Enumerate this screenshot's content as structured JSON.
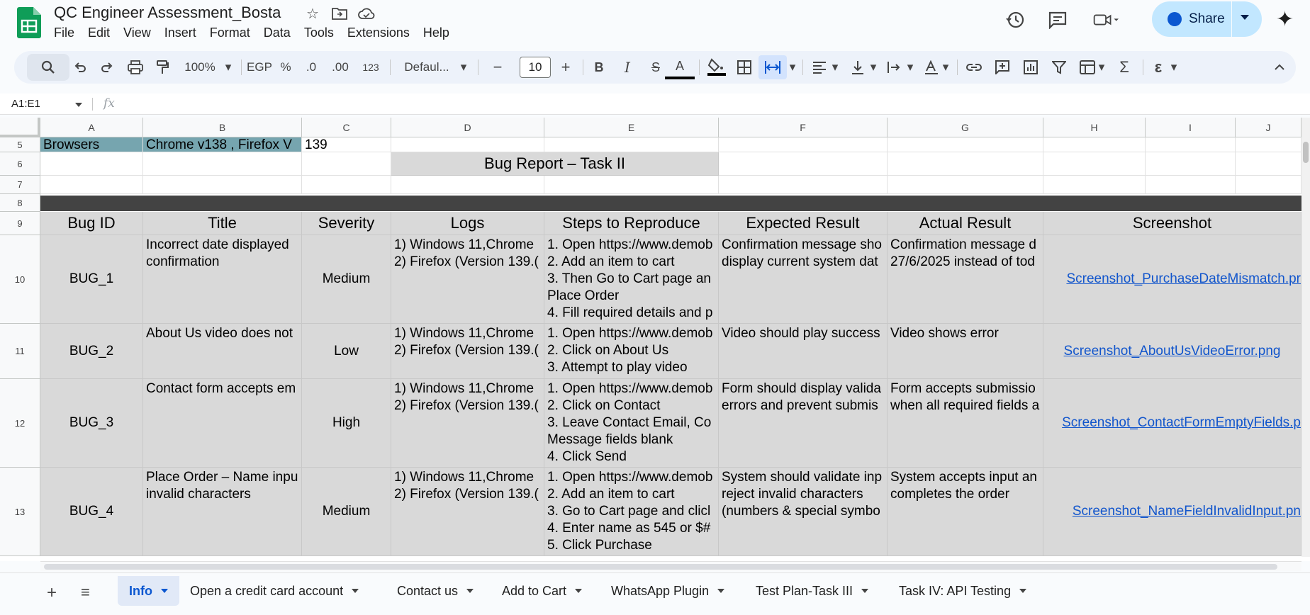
{
  "doc": {
    "title": "QC Engineer Assessment_Bosta",
    "menu": [
      "File",
      "Edit",
      "View",
      "Insert",
      "Format",
      "Data",
      "Tools",
      "Extensions",
      "Help"
    ],
    "share_label": "Share"
  },
  "toolbar": {
    "zoom": "100%",
    "currency": "EGP",
    "percent": "%",
    "dec_decrease": ".0",
    "dec_increase": ".00",
    "number_format": "123",
    "font": "Defaul...",
    "font_size": "10",
    "minus": "−",
    "plus": "+",
    "bold": "B",
    "italic": "I",
    "strike": "S",
    "text_color": "A",
    "sum": "Σ"
  },
  "formula_bar": {
    "name_box": "A1:E1",
    "fx": "fx"
  },
  "columns": [
    "A",
    "B",
    "C",
    "D",
    "E",
    "F",
    "G",
    "H",
    "I",
    "J"
  ],
  "rows": [
    "5",
    "6",
    "7",
    "8",
    "9",
    "10",
    "11",
    "12",
    "13"
  ],
  "sheet": {
    "row5": {
      "a": "Browsers",
      "b": "Chrome v138 , Firefox V",
      "c": "139"
    },
    "bug_report_title": "Bug Report – Task II",
    "headers": {
      "bug_id": "Bug ID",
      "title": "Title",
      "severity": "Severity",
      "logs": "Logs",
      "steps": "Steps to Reproduce",
      "expected": "Expected Result",
      "actual": "Actual Result",
      "screenshot": "Screenshot"
    },
    "bugs": [
      {
        "id": "BUG_1",
        "title_l1": "Incorrect date displayed",
        "title_l2": "confirmation",
        "severity": "Medium",
        "log1": "1) Windows 11,Chrome",
        "log2": "2) Firefox (Version 139.(",
        "step1": "1. Open https://www.demob",
        "step2": "2. Add an item to cart",
        "step3": "3. Then Go to Cart page an",
        "step4": "Place Order",
        "step5": "4. Fill required details and p",
        "exp1": "Confirmation message sho",
        "exp2": "display current system dat",
        "act1": "Confirmation message d",
        "act2": "27/6/2025 instead of tod",
        "screenshot": "Screenshot_PurchaseDateMismatch.pr"
      },
      {
        "id": "BUG_2",
        "title_l1": "About Us video does not",
        "severity": "Low",
        "log1": "1) Windows 11,Chrome",
        "log2": "2) Firefox (Version 139.(",
        "step1": "1. Open https://www.demob",
        "step2": "2. Click on About Us",
        "step3": "3. Attempt to play video",
        "exp1": "Video should play success",
        "act1": "Video shows error",
        "screenshot": "Screenshot_AboutUsVideoError.png"
      },
      {
        "id": "BUG_3",
        "title_l1": "Contact form accepts em",
        "severity": "High",
        "log1": "1) Windows 11,Chrome",
        "log2": "2) Firefox (Version 139.(",
        "step1": "1. Open https://www.demob",
        "step2": "2. Click on Contact",
        "step3": "3. Leave Contact Email, Co",
        "step4": "Message fields blank",
        "step5": "4. Click Send",
        "exp1": "Form should display valida",
        "exp2": "errors and prevent submis",
        "act1": "Form accepts submissio",
        "act2": "when all required fields a",
        "screenshot": "Screenshot_ContactFormEmptyFields.p"
      },
      {
        "id": "BUG_4",
        "title_l1": "Place Order – Name inpu",
        "title_l2": "invalid characters",
        "severity": "Medium",
        "log1": "1) Windows 11,Chrome",
        "log2": "2) Firefox (Version 139.(",
        "step1": "1. Open https://www.demob",
        "step2": "2. Add an item to cart",
        "step3": "3. Go to Cart page and clicl",
        "step4": "4. Enter name as 545 or $#",
        "step5": "5. Click Purchase",
        "exp1": "System should validate inp",
        "exp2": "reject invalid characters",
        "exp3": "(numbers & special symbo",
        "act1": "System accepts input an",
        "act2": "completes the order",
        "screenshot": "Screenshot_NameFieldInvalidInput.pn"
      }
    ]
  },
  "tabs": [
    "Info",
    "Open a credit card account",
    "Contact us",
    "Add to Cart",
    "WhatsApp Plugin",
    "Test Plan-Task III",
    "Task IV: API Testing"
  ],
  "colors": {
    "teal": "#76a5af",
    "header_gray": "#d9d9d9",
    "dark_band": "#434343",
    "link": "#1155cc",
    "share_bg": "#c2e7ff",
    "sheets_green": "#0f9d58"
  }
}
